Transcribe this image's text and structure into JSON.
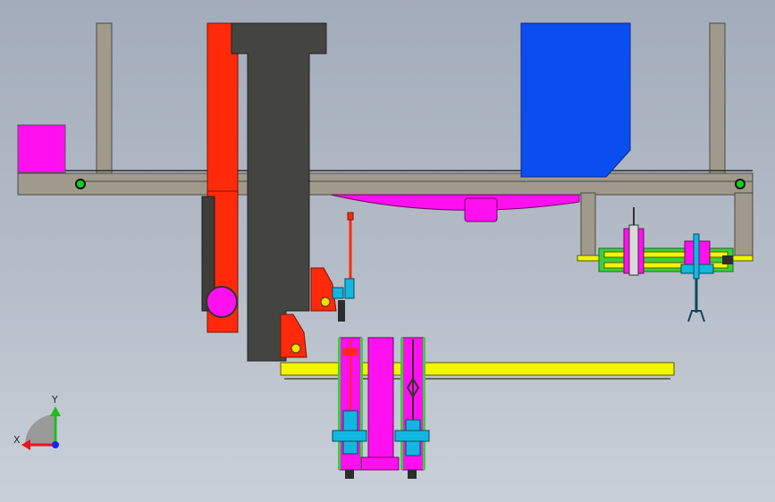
{
  "viewport": {
    "background_top": "#a3acbb",
    "background_bottom": "#c9d0d9"
  },
  "model": {
    "colors": {
      "frame": "#a09a8c",
      "frame_edge": "#4a4a44",
      "column": "#444440",
      "red_plate": "#ff2a0a",
      "blue_box": "#0a4ef0",
      "magenta": "#ff10ee",
      "yellow_rail": "#f4f400",
      "green_rail": "#39d13c",
      "cyan": "#11b7e0",
      "orange_bracket": "#ff2a0a",
      "dark": "#2d2d2d"
    }
  },
  "triad": {
    "x_label": "X",
    "y_label": "Y",
    "x_color": "#e8141e",
    "y_color": "#18c018",
    "z_color": "#1a24e6"
  }
}
